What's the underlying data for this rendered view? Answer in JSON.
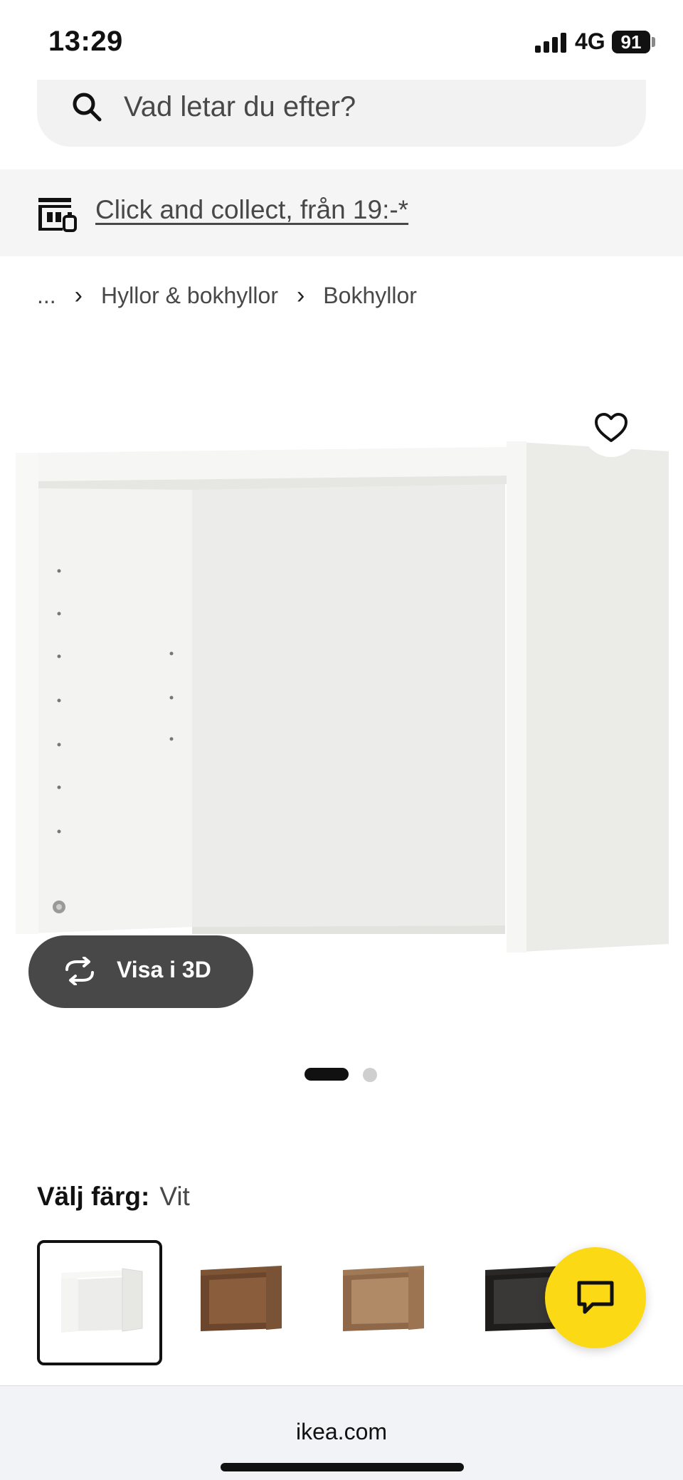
{
  "status_bar": {
    "time": "13:29",
    "network": "4G",
    "battery": "91"
  },
  "search": {
    "placeholder": "Vad letar du efter?"
  },
  "collect_banner": {
    "text": "Click and collect, från 19:-*"
  },
  "breadcrumb": {
    "ellipsis": "...",
    "items": [
      "Hyllor & bokhyllor",
      "Bokhyllor"
    ],
    "separator": "›"
  },
  "media": {
    "view_3d_label": "Visa i 3D",
    "slide_count": 2,
    "active_slide": 1
  },
  "color_selector": {
    "label": "Välj färg:",
    "value": "Vit",
    "swatches": [
      {
        "name": "white",
        "color": "#efefed",
        "selected": true
      },
      {
        "name": "walnut-dark",
        "color": "#7a5236",
        "selected": false
      },
      {
        "name": "walnut-light",
        "color": "#9c7451",
        "selected": false
      },
      {
        "name": "black",
        "color": "#2a2826",
        "selected": false
      }
    ]
  },
  "browser": {
    "url": "ikea.com"
  },
  "colors": {
    "chat_fab": "#fbd914",
    "view_3d_bg": "#484848",
    "banner_bg": "#f5f5f5"
  }
}
